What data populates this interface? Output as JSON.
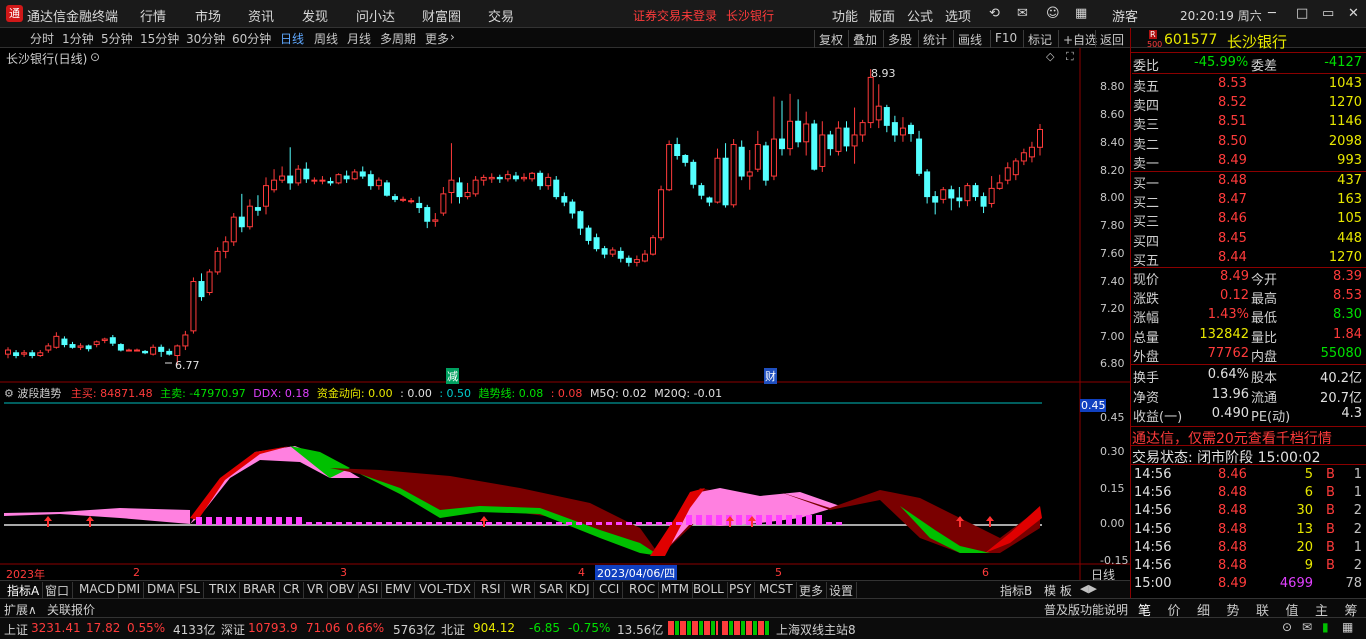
{
  "app": {
    "name": "通达信金融终端",
    "menus": [
      "行情",
      "市场",
      "资讯",
      "发现",
      "问小达",
      "财富圈",
      "交易"
    ],
    "notice": "证券交易未登录",
    "stock_link": "长沙银行",
    "right_menus": [
      "功能",
      "版面",
      "公式",
      "选项"
    ],
    "user": "游客",
    "clock": "20:20:19 周六"
  },
  "periods": [
    "分时",
    "1分钟",
    "5分钟",
    "15分钟",
    "30分钟",
    "60分钟",
    "日线",
    "周线",
    "月线",
    "多周期",
    "更多"
  ],
  "chart_tools": [
    "复权",
    "叠加",
    "多股",
    "统计",
    "画线",
    "F10",
    "标记",
    "+自选",
    "返回"
  ],
  "chart": {
    "title": "长沙银行(日线)",
    "high_label": "8.93",
    "low_label": "6.77",
    "mark_a": "减",
    "mark_b": "财",
    "y_ticks": [
      "8.80",
      "8.60",
      "8.40",
      "8.20",
      "8.00",
      "7.80",
      "7.60",
      "7.40",
      "7.20",
      "7.00",
      "6.80"
    ]
  },
  "indicator": {
    "name": "波段趋势",
    "zhumai": "主买: 84871.48",
    "zhumai2": "主卖: -47970.97",
    "ddx": "DDX: 0.18",
    "zjdx": "资金动向: 0.00",
    "v1": ": 0.00",
    "v2": ": 0.50",
    "qsx": "趋势线: 0.08",
    "v3": ": 0.08",
    "m5q": "M5Q: 0.02",
    "m20q": "M20Q: -0.01",
    "cursor_val": "0.45",
    "y_ticks": [
      "0.45",
      "0.30",
      "0.15",
      "0.00",
      "-0.15"
    ]
  },
  "x_axis": {
    "labels": [
      "2023年",
      "2",
      "3",
      "4",
      "5",
      "6"
    ],
    "cursor_date": "2023/04/06/四",
    "period": "日线"
  },
  "indicator_tabs": [
    "指标A",
    "窗口",
    "MACD",
    "DMI",
    "DMA",
    "FSL",
    "TRIX",
    "BRAR",
    "CR",
    "VR",
    "OBV",
    "ASI",
    "EMV",
    "VOL-TDX",
    "RSI",
    "WR",
    "SAR",
    "KDJ",
    "CCI",
    "ROC",
    "MTM",
    "BOLL",
    "PSY",
    "MCST",
    "更多",
    "设置"
  ],
  "indicator_b": "指标B",
  "template": "模 板",
  "ext": {
    "expand": "扩展∧",
    "related": "关联报价",
    "help": "普及版功能说明",
    "tabs": [
      "笔",
      "价",
      "细",
      "势",
      "联",
      "值",
      "主",
      "筹"
    ]
  },
  "quote": {
    "code": "601577",
    "name": "长沙银行",
    "weibi_label": "委比",
    "weibi": "-45.99%",
    "weicha_label": "委差",
    "weicha": "-4127",
    "sell": [
      {
        "label": "卖五",
        "price": "8.53",
        "vol": "1043"
      },
      {
        "label": "卖四",
        "price": "8.52",
        "vol": "1270"
      },
      {
        "label": "卖三",
        "price": "8.51",
        "vol": "1146"
      },
      {
        "label": "卖二",
        "price": "8.50",
        "vol": "2098"
      },
      {
        "label": "卖一",
        "price": "8.49",
        "vol": "993"
      }
    ],
    "buy": [
      {
        "label": "买一",
        "price": "8.48",
        "vol": "437"
      },
      {
        "label": "买二",
        "price": "8.47",
        "vol": "163"
      },
      {
        "label": "买三",
        "price": "8.46",
        "vol": "105"
      },
      {
        "label": "买四",
        "price": "8.45",
        "vol": "448"
      },
      {
        "label": "买五",
        "price": "8.44",
        "vol": "1270"
      }
    ],
    "stats": [
      {
        "l1": "现价",
        "v1": "8.49",
        "l2": "今开",
        "v2": "8.39"
      },
      {
        "l1": "涨跌",
        "v1": "0.12",
        "l2": "最高",
        "v2": "8.53"
      },
      {
        "l1": "涨幅",
        "v1": "1.43%",
        "l2": "最低",
        "v2": "8.30"
      },
      {
        "l1": "总量",
        "v1": "132842",
        "l2": "量比",
        "v2": "1.84"
      },
      {
        "l1": "外盘",
        "v1": "77762",
        "l2": "内盘",
        "v2": "55080"
      }
    ],
    "stats2": [
      {
        "l1": "换手",
        "v1": "0.64%",
        "l2": "股本",
        "v2": "40.2亿"
      },
      {
        "l1": "净资",
        "v1": "13.96",
        "l2": "流通",
        "v2": "20.7亿"
      },
      {
        "l1": "收益(一)",
        "v1": "0.490",
        "l2": "PE(动)",
        "v2": "4.3"
      }
    ],
    "ad": "通达信，仅需20元查看千档行情",
    "status": "交易状态: 闭市阶段 15:00:02",
    "ticks": [
      {
        "t": "14:56",
        "p": "8.46",
        "v": "5",
        "s": "B",
        "n": "1"
      },
      {
        "t": "14:56",
        "p": "8.48",
        "v": "6",
        "s": "B",
        "n": "1"
      },
      {
        "t": "14:56",
        "p": "8.48",
        "v": "30",
        "s": "B",
        "n": "2"
      },
      {
        "t": "14:56",
        "p": "8.48",
        "v": "13",
        "s": "B",
        "n": "2"
      },
      {
        "t": "14:56",
        "p": "8.48",
        "v": "20",
        "s": "B",
        "n": "1"
      },
      {
        "t": "14:56",
        "p": "8.48",
        "v": "9",
        "s": "B",
        "n": "2"
      },
      {
        "t": "15:00",
        "p": "8.49",
        "v": "4699",
        "s": "",
        "n": "78"
      }
    ]
  },
  "statusbar": {
    "sh_label": "上证",
    "sh": "3231.41",
    "sh_chg": "17.82",
    "sh_pct": "0.55%",
    "sh_amt": "4133亿",
    "sz_label": "深证",
    "sz": "10793.9",
    "sz_chg": "71.06",
    "sz_pct": "0.66%",
    "sz_amt": "5763亿",
    "bz_label": "北证",
    "bz": "904.12",
    "bz_chg": "-6.85",
    "bz_pct": "-0.75%",
    "bz_amt": "13.56亿",
    "server": "上海双线主站8"
  },
  "chart_data": {
    "type": "candlestick",
    "ylim": [
      6.7,
      8.95
    ],
    "candles": [
      [
        6.85,
        6.88,
        6.82,
        6.9
      ],
      [
        6.86,
        6.84,
        6.82,
        6.88
      ],
      [
        6.85,
        6.86,
        6.83,
        6.88
      ],
      [
        6.86,
        6.84,
        6.82,
        6.88
      ],
      [
        6.84,
        6.86,
        6.83,
        6.88
      ],
      [
        6.88,
        6.91,
        6.86,
        6.93
      ],
      [
        6.9,
        6.98,
        6.89,
        7.01
      ],
      [
        6.96,
        6.92,
        6.9,
        6.98
      ],
      [
        6.92,
        6.9,
        6.89,
        6.94
      ],
      [
        6.9,
        6.91,
        6.88,
        6.93
      ],
      [
        6.91,
        6.89,
        6.87,
        6.92
      ],
      [
        6.92,
        6.94,
        6.9,
        6.95
      ],
      [
        6.95,
        6.96,
        6.93,
        6.97
      ],
      [
        6.97,
        6.93,
        6.91,
        6.99
      ],
      [
        6.92,
        6.88,
        6.87,
        6.93
      ],
      [
        6.88,
        6.88,
        6.87,
        6.89
      ],
      [
        6.88,
        6.88,
        6.87,
        6.89
      ],
      [
        6.87,
        6.86,
        6.85,
        6.88
      ],
      [
        6.85,
        6.9,
        6.84,
        6.92
      ],
      [
        6.9,
        6.87,
        6.83,
        6.92
      ],
      [
        6.87,
        6.85,
        6.84,
        6.89
      ],
      [
        6.84,
        6.91,
        6.77,
        6.92
      ],
      [
        6.91,
        6.99,
        6.88,
        7.02
      ],
      [
        7.02,
        7.38,
        7.0,
        7.41
      ],
      [
        7.38,
        7.27,
        7.24,
        7.44
      ],
      [
        7.3,
        7.45,
        7.28,
        7.47
      ],
      [
        7.45,
        7.6,
        7.43,
        7.63
      ],
      [
        7.6,
        7.67,
        7.55,
        7.71
      ],
      [
        7.67,
        7.85,
        7.64,
        7.88
      ],
      [
        7.85,
        7.78,
        7.74,
        8.02
      ],
      [
        7.78,
        7.93,
        7.76,
        7.98
      ],
      [
        7.92,
        7.9,
        7.86,
        8.01
      ],
      [
        7.93,
        8.08,
        7.87,
        8.14
      ],
      [
        8.05,
        8.12,
        8.03,
        8.2
      ],
      [
        8.12,
        8.15,
        8.1,
        8.22
      ],
      [
        8.15,
        8.1,
        8.05,
        8.36
      ],
      [
        8.1,
        8.2,
        8.08,
        8.23
      ],
      [
        8.2,
        8.13,
        8.1,
        8.25
      ],
      [
        8.12,
        8.12,
        8.09,
        8.14
      ],
      [
        8.12,
        8.12,
        8.09,
        8.15
      ],
      [
        8.11,
        8.1,
        8.08,
        8.14
      ],
      [
        8.1,
        8.16,
        8.09,
        8.17
      ],
      [
        8.15,
        8.13,
        8.1,
        8.19
      ],
      [
        8.13,
        8.18,
        8.12,
        8.2
      ],
      [
        8.18,
        8.15,
        8.13,
        8.22
      ],
      [
        8.16,
        8.08,
        8.05,
        8.19
      ],
      [
        8.08,
        8.12,
        8.05,
        8.14
      ],
      [
        8.1,
        8.01,
        8.0,
        8.12
      ],
      [
        8.0,
        7.98,
        7.96,
        8.02
      ],
      [
        7.98,
        7.98,
        7.96,
        8.0
      ],
      [
        7.97,
        7.97,
        7.95,
        7.99
      ],
      [
        7.95,
        7.92,
        7.88,
        8.0
      ],
      [
        7.92,
        7.82,
        7.77,
        7.94
      ],
      [
        7.82,
        7.83,
        7.78,
        7.88
      ],
      [
        7.88,
        8.02,
        7.86,
        8.07
      ],
      [
        8.03,
        8.12,
        7.95,
        8.39
      ],
      [
        8.1,
        8.0,
        7.95,
        8.14
      ],
      [
        8.0,
        8.03,
        7.98,
        8.1
      ],
      [
        8.02,
        8.12,
        8.0,
        8.15
      ],
      [
        8.12,
        8.14,
        8.08,
        8.16
      ],
      [
        8.13,
        8.14,
        8.1,
        8.17
      ],
      [
        8.14,
        8.13,
        8.1,
        8.16
      ],
      [
        8.13,
        8.16,
        8.11,
        8.19
      ],
      [
        8.15,
        8.13,
        8.11,
        8.18
      ],
      [
        8.13,
        8.14,
        8.11,
        8.17
      ],
      [
        8.13,
        8.17,
        8.11,
        8.18
      ],
      [
        8.17,
        8.08,
        8.05,
        8.19
      ],
      [
        8.08,
        8.14,
        8.05,
        8.17
      ],
      [
        8.12,
        8.0,
        7.98,
        8.15
      ],
      [
        8.0,
        7.96,
        7.93,
        8.03
      ],
      [
        7.96,
        7.88,
        7.84,
        7.98
      ],
      [
        7.89,
        7.77,
        7.72,
        7.9
      ],
      [
        7.77,
        7.68,
        7.65,
        7.79
      ],
      [
        7.7,
        7.62,
        7.6,
        7.73
      ],
      [
        7.62,
        7.58,
        7.55,
        7.64
      ],
      [
        7.58,
        7.61,
        7.56,
        7.63
      ],
      [
        7.6,
        7.55,
        7.52,
        7.63
      ],
      [
        7.55,
        7.52,
        7.49,
        7.57
      ],
      [
        7.52,
        7.54,
        7.49,
        7.57
      ],
      [
        7.53,
        7.58,
        7.52,
        7.61
      ],
      [
        7.58,
        7.7,
        7.57,
        7.72
      ],
      [
        7.7,
        8.05,
        7.68,
        8.08
      ],
      [
        8.05,
        8.38,
        8.04,
        8.41
      ],
      [
        8.38,
        8.3,
        8.27,
        8.43
      ],
      [
        8.3,
        8.25,
        8.22,
        8.31
      ],
      [
        8.25,
        8.09,
        8.06,
        8.27
      ],
      [
        8.08,
        8.01,
        7.98,
        8.1
      ],
      [
        7.99,
        7.96,
        7.93,
        8.0
      ],
      [
        7.96,
        8.28,
        7.95,
        8.35
      ],
      [
        8.28,
        7.94,
        7.92,
        8.39
      ],
      [
        7.94,
        8.38,
        7.92,
        8.42
      ],
      [
        8.36,
        8.15,
        8.12,
        8.41
      ],
      [
        8.15,
        8.18,
        8.05,
        8.34
      ],
      [
        8.2,
        8.38,
        8.18,
        8.48
      ],
      [
        8.37,
        8.12,
        8.08,
        8.4
      ],
      [
        8.15,
        8.42,
        8.12,
        8.73
      ],
      [
        8.42,
        8.35,
        8.3,
        8.7
      ],
      [
        8.35,
        8.55,
        8.3,
        8.75
      ],
      [
        8.55,
        8.4,
        8.36,
        8.71
      ],
      [
        8.4,
        8.53,
        8.3,
        8.62
      ],
      [
        8.53,
        8.2,
        8.19,
        8.56
      ],
      [
        8.22,
        8.45,
        8.18,
        8.55
      ],
      [
        8.45,
        8.35,
        8.3,
        8.48
      ],
      [
        8.33,
        8.5,
        8.3,
        8.55
      ],
      [
        8.5,
        8.37,
        8.33,
        8.55
      ],
      [
        8.37,
        8.45,
        8.24,
        8.65
      ],
      [
        8.45,
        8.54,
        8.4,
        8.56
      ],
      [
        8.54,
        8.87,
        8.5,
        8.93
      ],
      [
        8.56,
        8.66,
        8.5,
        8.82
      ],
      [
        8.65,
        8.52,
        8.47,
        8.67
      ],
      [
        8.54,
        8.45,
        8.4,
        8.59
      ],
      [
        8.45,
        8.5,
        8.4,
        8.58
      ],
      [
        8.52,
        8.46,
        8.4,
        8.54
      ],
      [
        8.42,
        8.17,
        8.15,
        8.48
      ],
      [
        8.18,
        8.0,
        7.95,
        8.2
      ],
      [
        8.0,
        7.96,
        7.87,
        8.04
      ],
      [
        7.98,
        8.05,
        7.95,
        8.07
      ],
      [
        8.05,
        7.99,
        7.9,
        8.08
      ],
      [
        7.99,
        7.97,
        7.92,
        8.07
      ],
      [
        7.97,
        8.08,
        7.93,
        8.1
      ],
      [
        8.08,
        8.0,
        7.97,
        8.1
      ],
      [
        8.0,
        7.93,
        7.88,
        8.03
      ],
      [
        7.95,
        8.06,
        7.92,
        8.15
      ],
      [
        8.06,
        8.1,
        8.05,
        8.16
      ],
      [
        8.12,
        8.21,
        8.09,
        8.25
      ],
      [
        8.16,
        8.26,
        8.12,
        8.28
      ],
      [
        8.26,
        8.32,
        8.23,
        8.35
      ],
      [
        8.29,
        8.36,
        8.25,
        8.4
      ],
      [
        8.36,
        8.49,
        8.3,
        8.53
      ]
    ]
  }
}
